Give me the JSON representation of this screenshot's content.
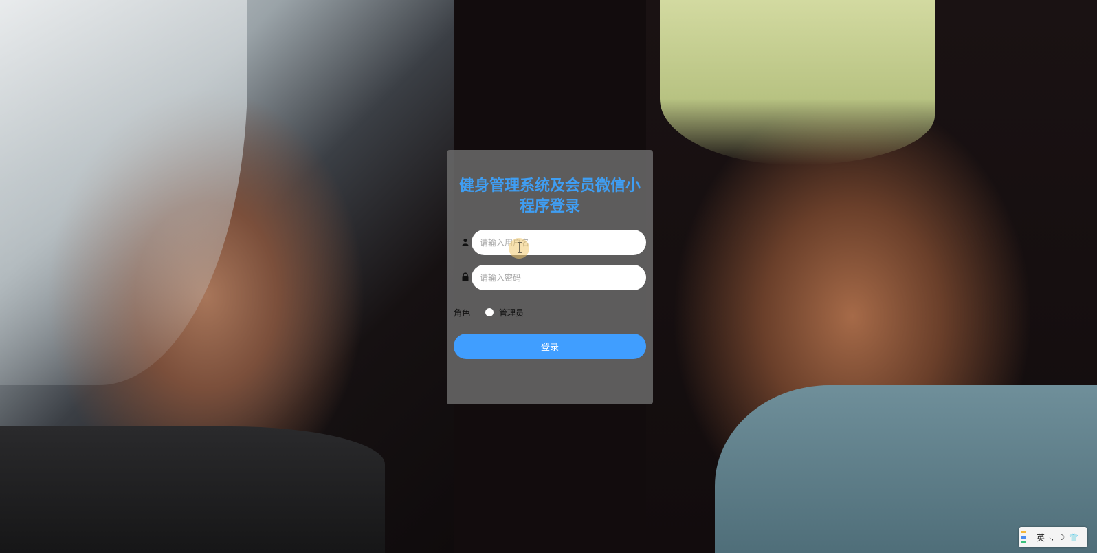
{
  "login": {
    "title": "健身管理系统及会员微信小程序登录",
    "username_placeholder": "请输入用户名",
    "password_placeholder": "请输入密码",
    "role_label": "角色",
    "role_option": "管理员",
    "submit_label": "登录"
  },
  "ime": {
    "language": "英",
    "icons": [
      "punctuation-icon",
      "moon-icon",
      "shirt-icon"
    ]
  },
  "colors": {
    "title": "#3f9ef3",
    "button": "#409eff",
    "panel": "rgba(110,110,110,0.82)"
  }
}
